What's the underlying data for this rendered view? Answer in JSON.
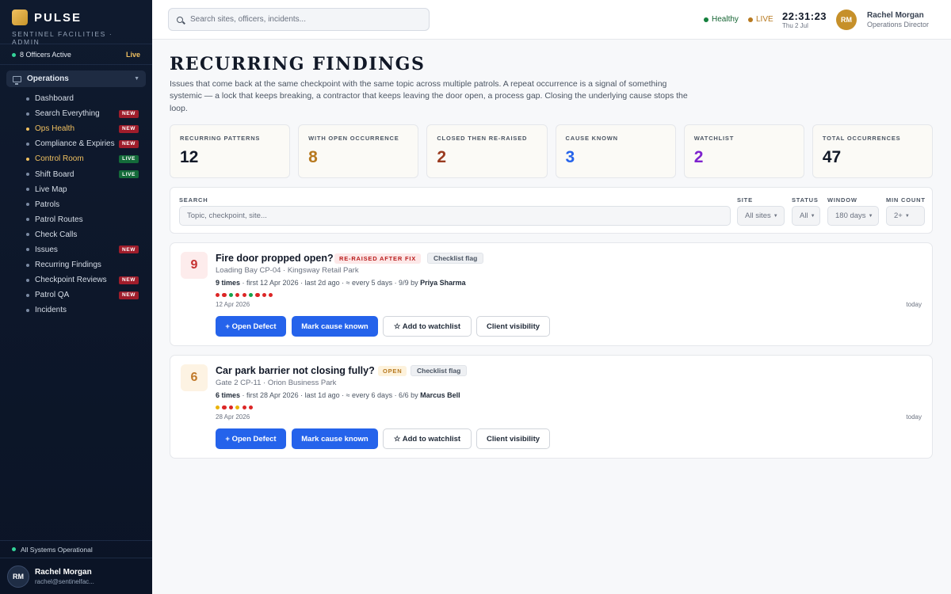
{
  "brand": {
    "name": "PULSE",
    "subtitle": "SENTINEL FACILITIES · ADMIN"
  },
  "sidebar": {
    "officers_active": "8 Officers Active",
    "live_label": "Live",
    "group_label": "Operations",
    "group_icon": "monitor-icon",
    "items": [
      {
        "label": "Dashboard",
        "badge": ""
      },
      {
        "label": "Search Everything",
        "badge": "NEW"
      },
      {
        "label": "Ops Health",
        "badge": "NEW"
      },
      {
        "label": "Compliance & Expiries",
        "badge": "NEW"
      },
      {
        "label": "Control Room",
        "badge": "LIVE"
      },
      {
        "label": "Shift Board",
        "badge": "LIVE"
      },
      {
        "label": "Live Map",
        "badge": ""
      },
      {
        "label": "Patrols",
        "badge": ""
      },
      {
        "label": "Patrol Routes",
        "badge": ""
      },
      {
        "label": "Check Calls",
        "badge": ""
      },
      {
        "label": "Issues",
        "badge": "NEW"
      },
      {
        "label": "Recurring Findings",
        "badge": ""
      },
      {
        "label": "Checkpoint Reviews",
        "badge": "NEW"
      },
      {
        "label": "Patrol QA",
        "badge": "NEW"
      },
      {
        "label": "Incidents",
        "badge": ""
      }
    ],
    "system_status": "All Systems Operational",
    "user": {
      "initials": "RM",
      "name": "Rachel Morgan",
      "email": "rachel@sentinelfac..."
    }
  },
  "header": {
    "search_placeholder": "Search sites, officers, incidents...",
    "health_label": "Healthy",
    "live_label": "LIVE",
    "time": "22:31:23",
    "date": "Thu 2 Jul",
    "user": {
      "initials": "RM",
      "name": "Rachel Morgan",
      "role": "Operations Director"
    }
  },
  "page": {
    "title": "RECURRING FINDINGS",
    "description": "Issues that come back at the same checkpoint with the same topic across multiple patrols. A repeat occurrence is a signal of something systemic — a lock that keeps breaking, a contractor that keeps leaving the door open, a process gap. Closing the underlying cause stops the loop."
  },
  "stats": [
    {
      "label": "RECURRING PATTERNS",
      "value": "12",
      "color": "#111827"
    },
    {
      "label": "WITH OPEN OCCURRENCE",
      "value": "8",
      "color": "#b7791f"
    },
    {
      "label": "CLOSED THEN RE-RAISED",
      "value": "2",
      "color": "#9a3b1f"
    },
    {
      "label": "CAUSE KNOWN",
      "value": "3",
      "color": "#2563eb"
    },
    {
      "label": "WATCHLIST",
      "value": "2",
      "color": "#7e22ce"
    },
    {
      "label": "TOTAL OCCURRENCES",
      "value": "47",
      "color": "#111827"
    }
  ],
  "filters": {
    "search_label": "SEARCH",
    "search_placeholder": "Topic, checkpoint, site...",
    "site_label": "SITE",
    "site_value": "All sites",
    "status_label": "STATUS",
    "status_value": "All",
    "window_label": "WINDOW",
    "window_value": "180 days",
    "min_count_label": "MIN COUNT",
    "min_count_value": "2+"
  },
  "findings": [
    {
      "count": "9",
      "title": "Fire door propped open?",
      "status": "RE-RAISED AFTER FIX",
      "type": "Checklist flag",
      "location": "Loading Bay CP-04 · Kingsway Retail Park",
      "times": "9 times",
      "meta": " · first 12 Apr 2026 · last 2d ago · ≈ every 5 days · 9/9 by ",
      "by": "Priya Sharma",
      "first_date": "12 Apr 2026",
      "last_label": "today",
      "dot_colors": [
        "#dc2626",
        "#dc2626",
        "#16a34a",
        "#dc2626",
        "#dc2626",
        "#16a34a",
        "#dc2626",
        "#dc2626",
        "#dc2626"
      ],
      "buttons": {
        "defect": "+ Open Defect",
        "cause": "Mark cause known",
        "watch": "☆ Add to watchlist",
        "client": "Client visibility"
      }
    },
    {
      "count": "6",
      "title": "Car park barrier not closing fully?",
      "status": "OPEN",
      "type": "Checklist flag",
      "location": "Gate 2 CP-11 · Orion Business Park",
      "times": "6 times",
      "meta": " · first 28 Apr 2026 · last 1d ago · ≈ every 6 days · 6/6 by ",
      "by": "Marcus Bell",
      "first_date": "28 Apr 2026",
      "last_label": "today",
      "dot_colors": [
        "#eab308",
        "#dc2626",
        "#dc2626",
        "#eab308",
        "#dc2626",
        "#dc2626"
      ],
      "buttons": {
        "defect": "+ Open Defect",
        "cause": "Mark cause known",
        "watch": "☆ Add to watchlist",
        "client": "Client visibility"
      }
    }
  ]
}
